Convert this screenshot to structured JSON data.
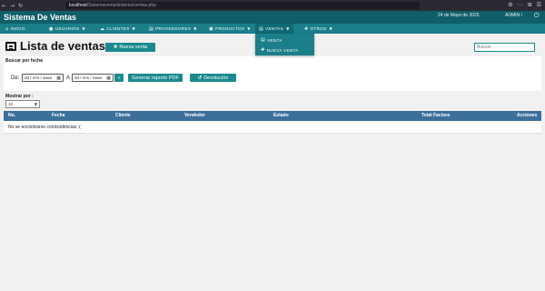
{
  "browser": {
    "url_host": "localhost",
    "url_path": "/Sistemaventa/sistema/ventas.php",
    "nav_back": "←",
    "nav_forward": "→",
    "nav_reload": "↻",
    "right_icons": [
      "⚙",
      "⋯",
      "⊞",
      "☰"
    ]
  },
  "header": {
    "title": "Sistema De Ventas",
    "date": "24 de Mayo de 2025",
    "user": "ADMIN I",
    "power_icon": "⏻"
  },
  "nav": {
    "items": [
      {
        "label": "INICIO",
        "icon": "⌂"
      },
      {
        "label": "USUARIOS",
        "icon": "●"
      },
      {
        "label": "CLIENTES",
        "icon": "☁"
      },
      {
        "label": "PROVEEDORES",
        "icon": "▤"
      },
      {
        "label": "PRODUCTOS",
        "icon": "▣"
      },
      {
        "label": "VENTAS",
        "icon": "▤"
      },
      {
        "label": "OTROS",
        "icon": "✚"
      }
    ],
    "active": "VENTAS"
  },
  "ventas_menu": {
    "items": [
      {
        "label": "VENTA",
        "icon": "▤"
      },
      {
        "label": "NUEVA VENTA",
        "icon": "✚"
      }
    ]
  },
  "main": {
    "title": "Lista de ventas",
    "new_button": "Nueva venta",
    "new_button_icon": "✚",
    "search_placeholder": "Buscar"
  },
  "filter": {
    "label": "Buscar por fecha",
    "from_label": "De:",
    "to_label": "A",
    "date_placeholder": "dd / mm / aaaa",
    "pdf_button": "Generar reporte PDF",
    "dev_button": "Devolución",
    "dev_icon": "↺",
    "search_icon": "⌕"
  },
  "show": {
    "label": "Mostrar por :",
    "selected": "10"
  },
  "table": {
    "columns": [
      "No.",
      "Fecha",
      "Cliente",
      "Vendedor",
      "Estado",
      "Total Factura",
      "Acciones"
    ],
    "empty_message": "No se encontraron conincidencias :("
  },
  "colors": {
    "header_bg": "#0f5e69",
    "nav_bg": "#1a7f8a",
    "button_bg": "#1a8a8f",
    "table_head_bg": "#3c6f9a"
  }
}
